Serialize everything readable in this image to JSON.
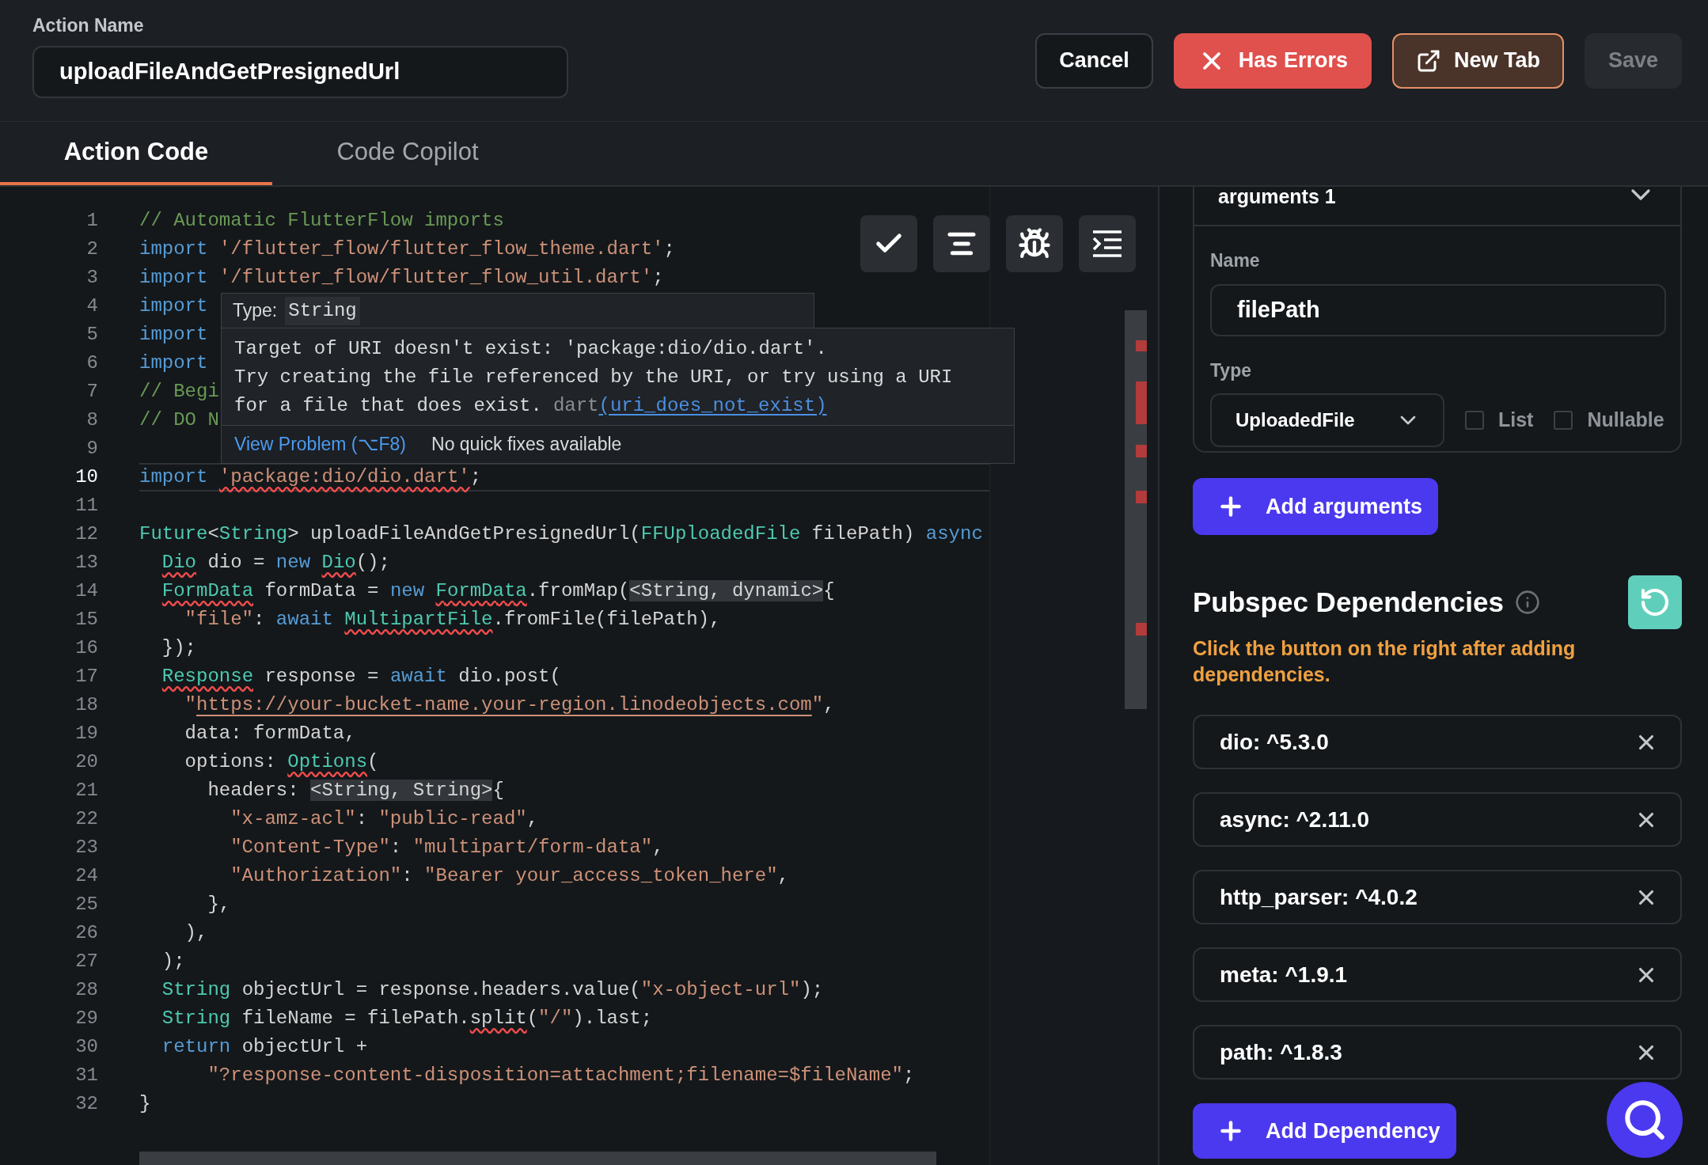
{
  "header": {
    "label": "Action Name",
    "action_name": "uploadFileAndGetPresignedUrl",
    "buttons": [
      {
        "label": "Cancel",
        "kind": "cancel",
        "disabled": false
      },
      {
        "label": "Has Errors",
        "kind": "error",
        "disabled": false
      },
      {
        "label": "New Tab",
        "kind": "external",
        "disabled": false
      },
      {
        "label": "Save",
        "kind": "save",
        "disabled": true
      }
    ]
  },
  "tabs": [
    {
      "label": "Action Code",
      "selected": true
    },
    {
      "label": "Code Copilot",
      "selected": false
    }
  ],
  "editor": {
    "lines": [
      {
        "number": "1",
        "current": false,
        "tokens": [
          {
            "kind": "comment",
            "text": "// Automatic FlutterFlow imports",
            "error": false
          }
        ]
      },
      {
        "number": "2",
        "current": false,
        "tokens": [
          {
            "kind": "keyword",
            "text": "import",
            "error": false
          },
          {
            "kind": "string",
            "text": " '/flutter_flow/flutter_flow_theme.dart'",
            "error": false
          },
          {
            "kind": "plain",
            "text": ";",
            "error": false
          }
        ]
      },
      {
        "number": "3",
        "current": false,
        "tokens": [
          {
            "kind": "keyword",
            "text": "import",
            "error": false
          },
          {
            "kind": "string",
            "text": " '/flutter_flow/flutter_flow_util.dart'",
            "error": false
          },
          {
            "kind": "plain",
            "text": ";",
            "error": false
          }
        ]
      },
      {
        "number": "4",
        "current": false,
        "tokens": [
          {
            "kind": "keyword",
            "text": "import",
            "error": false
          }
        ]
      },
      {
        "number": "5",
        "current": false,
        "tokens": [
          {
            "kind": "keyword",
            "text": "import",
            "error": false
          }
        ]
      },
      {
        "number": "6",
        "current": false,
        "tokens": [
          {
            "kind": "keyword",
            "text": "import",
            "error": false
          }
        ]
      },
      {
        "number": "7",
        "current": false,
        "tokens": [
          {
            "kind": "comment",
            "text": "// Begi",
            "error": false
          }
        ]
      },
      {
        "number": "8",
        "current": false,
        "tokens": [
          {
            "kind": "comment",
            "text": "// DO N",
            "error": false
          }
        ]
      },
      {
        "number": "9",
        "current": false
      },
      {
        "number": "10",
        "current": true,
        "tokens": [
          {
            "kind": "keyword",
            "text": "import",
            "error": false
          },
          {
            "kind": "string",
            "text": " 'package:dio/dio.dart'",
            "error": true
          },
          {
            "kind": "plain",
            "text": ";",
            "error": false
          }
        ]
      },
      {
        "number": "11",
        "current": false
      },
      {
        "number": "12",
        "current": false,
        "tokens": [
          {
            "kind": "type",
            "text": "Future",
            "error": false
          },
          {
            "kind": "plain",
            "text": "<",
            "error": false
          },
          {
            "kind": "type",
            "text": "String",
            "error": false
          },
          {
            "kind": "plain",
            "text": "> uploadFileAndGetPresignedUrl(",
            "error": false
          },
          {
            "kind": "type",
            "text": "FFUploadedFile",
            "error": false
          },
          {
            "kind": "plain",
            "text": " filePath)",
            "error": false
          },
          {
            "kind": "keyword",
            "text": " async",
            "error": false
          }
        ]
      },
      {
        "number": "13",
        "current": false,
        "tokens": [
          {
            "kind": "type",
            "text": "  Dio",
            "error": true
          },
          {
            "kind": "plain",
            "text": " dio = ",
            "error": false
          },
          {
            "kind": "keyword",
            "text": "new",
            "error": false
          },
          {
            "kind": "type",
            "text": " Dio",
            "error": true
          },
          {
            "kind": "plain",
            "text": "();",
            "error": false
          }
        ]
      },
      {
        "number": "14",
        "current": false,
        "tokens": [
          {
            "kind": "type",
            "text": "  FormData",
            "error": true
          },
          {
            "kind": "plain",
            "text": " formData = ",
            "error": false
          },
          {
            "kind": "keyword",
            "text": "new",
            "error": false
          },
          {
            "kind": "type",
            "text": " FormData",
            "error": true
          },
          {
            "kind": "plain",
            "text": ".fromMap(",
            "error": false
          },
          {
            "kind": "hint",
            "text": "<String, dynamic>",
            "error": false
          },
          {
            "kind": "plain",
            "text": "{",
            "error": false
          }
        ]
      },
      {
        "number": "15",
        "current": false,
        "tokens": [
          {
            "kind": "string",
            "text": "    \"file\"",
            "error": false
          },
          {
            "kind": "plain",
            "text": ": ",
            "error": false
          },
          {
            "kind": "keyword",
            "text": "await",
            "error": false
          },
          {
            "kind": "type",
            "text": " MultipartFile",
            "error": true
          },
          {
            "kind": "plain",
            "text": ".fromFile(filePath),",
            "error": false
          }
        ]
      },
      {
        "number": "16",
        "current": false,
        "tokens": [
          {
            "kind": "plain",
            "text": "  });",
            "error": false
          }
        ]
      },
      {
        "number": "17",
        "current": false,
        "tokens": [
          {
            "kind": "type",
            "text": "  Response",
            "error": true
          },
          {
            "kind": "plain",
            "text": " response = ",
            "error": false
          },
          {
            "kind": "keyword",
            "text": "await",
            "error": false
          },
          {
            "kind": "plain",
            "text": " dio.post(",
            "error": false
          }
        ]
      },
      {
        "number": "18",
        "current": false,
        "tokens": [
          {
            "kind": "string",
            "text": "    \"",
            "error": false
          },
          {
            "kind": "url",
            "text": "https://your-bucket-name.your-region.linodeobjects.com",
            "error": false
          },
          {
            "kind": "string",
            "text": "\"",
            "error": false
          },
          {
            "kind": "plain",
            "text": ",",
            "error": false
          }
        ]
      },
      {
        "number": "19",
        "current": false,
        "tokens": [
          {
            "kind": "plain",
            "text": "    data: formData,",
            "error": false
          }
        ]
      },
      {
        "number": "20",
        "current": false,
        "tokens": [
          {
            "kind": "plain",
            "text": "    options: ",
            "error": false
          },
          {
            "kind": "type",
            "text": "Options",
            "error": true
          },
          {
            "kind": "plain",
            "text": "(",
            "error": false
          }
        ]
      },
      {
        "number": "21",
        "current": false,
        "tokens": [
          {
            "kind": "plain",
            "text": "      headers: ",
            "error": false
          },
          {
            "kind": "hint",
            "text": "<String, String>",
            "error": false
          },
          {
            "kind": "plain",
            "text": "{",
            "error": false
          }
        ]
      },
      {
        "number": "22",
        "current": false,
        "tokens": [
          {
            "kind": "string",
            "text": "        \"x-amz-acl\"",
            "error": false
          },
          {
            "kind": "plain",
            "text": ": ",
            "error": false
          },
          {
            "kind": "string",
            "text": "\"public-read\"",
            "error": false
          },
          {
            "kind": "plain",
            "text": ",",
            "error": false
          }
        ]
      },
      {
        "number": "23",
        "current": false,
        "tokens": [
          {
            "kind": "string",
            "text": "        \"Content-Type\"",
            "error": false
          },
          {
            "kind": "plain",
            "text": ": ",
            "error": false
          },
          {
            "kind": "string",
            "text": "\"multipart/form-data\"",
            "error": false
          },
          {
            "kind": "plain",
            "text": ",",
            "error": false
          }
        ]
      },
      {
        "number": "24",
        "current": false,
        "tokens": [
          {
            "kind": "string",
            "text": "        \"Authorization\"",
            "error": false
          },
          {
            "kind": "plain",
            "text": ": ",
            "error": false
          },
          {
            "kind": "string",
            "text": "\"Bearer your_access_token_here\"",
            "error": false
          },
          {
            "kind": "plain",
            "text": ",",
            "error": false
          }
        ]
      },
      {
        "number": "25",
        "current": false,
        "tokens": [
          {
            "kind": "plain",
            "text": "      },",
            "error": false
          }
        ]
      },
      {
        "number": "26",
        "current": false,
        "tokens": [
          {
            "kind": "plain",
            "text": "    ),",
            "error": false
          }
        ]
      },
      {
        "number": "27",
        "current": false,
        "tokens": [
          {
            "kind": "plain",
            "text": "  );",
            "error": false
          }
        ]
      },
      {
        "number": "28",
        "current": false,
        "tokens": [
          {
            "kind": "type",
            "text": "  String",
            "error": false
          },
          {
            "kind": "plain",
            "text": " objectUrl = response.headers.value(",
            "error": false
          },
          {
            "kind": "string",
            "text": "\"x-object-url\"",
            "error": false
          },
          {
            "kind": "plain",
            "text": ");",
            "error": false
          }
        ]
      },
      {
        "number": "29",
        "current": false,
        "tokens": [
          {
            "kind": "type",
            "text": "  String",
            "error": false
          },
          {
            "kind": "plain",
            "text": " fileName = filePath.",
            "error": false
          },
          {
            "kind": "plain",
            "text": "split",
            "error": true
          },
          {
            "kind": "plain",
            "text": "(",
            "error": false
          },
          {
            "kind": "string",
            "text": "\"/\"",
            "error": false
          },
          {
            "kind": "plain",
            "text": ").last;",
            "error": false
          }
        ]
      },
      {
        "number": "30",
        "current": false,
        "tokens": [
          {
            "kind": "keyword",
            "text": "  return",
            "error": false
          },
          {
            "kind": "plain",
            "text": " objectUrl +",
            "error": false
          }
        ]
      },
      {
        "number": "31",
        "current": false,
        "tokens": [
          {
            "kind": "string",
            "text": "      \"?response-content-disposition=attachment;filename=$fileName\"",
            "error": false
          },
          {
            "kind": "plain",
            "text": ";",
            "error": false
          }
        ]
      },
      {
        "number": "32",
        "current": false,
        "tokens": [
          {
            "kind": "plain",
            "text": "}",
            "error": false
          }
        ]
      }
    ],
    "tooltip": {
      "type_label": "Type:",
      "type_value": "String",
      "message": [
        "Target of URI doesn't exist: 'package:dio/dio.dart'.",
        "Try creating the file referenced by the URI, or try using a URI",
        "for a file that does exist."
      ],
      "source": "dart",
      "code": "(uri_does_not_exist)",
      "view_problem": "View Problem (⌥F8)",
      "quick_fix": "No quick fixes available"
    }
  },
  "arguments": {
    "title": "arguments 1",
    "name_label": "Name",
    "name_value": "filePath",
    "type_label": "Type",
    "type_value": "UploadedFile",
    "options": [
      {
        "label": "List",
        "checked": false
      },
      {
        "label": "Nullable",
        "checked": false
      }
    ],
    "add_button": "Add arguments"
  },
  "dependencies": {
    "title": "Pubspec Dependencies",
    "hint": "Click the button on the right after adding dependencies.",
    "items": [
      {
        "name": "dio: ^5.3.0"
      },
      {
        "name": "async: ^2.11.0"
      },
      {
        "name": "http_parser: ^4.0.2"
      },
      {
        "name": "meta: ^1.9.1"
      },
      {
        "name": "path: ^1.8.3"
      }
    ],
    "add_button": "Add Dependency"
  }
}
